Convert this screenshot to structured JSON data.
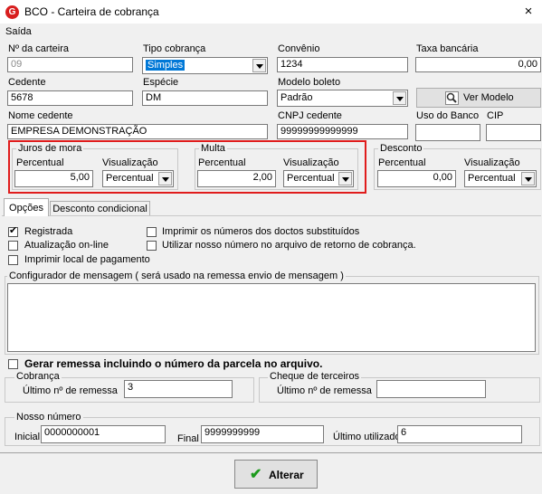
{
  "window": {
    "title": "BCO - Carteira de cobrança",
    "icon": "app-logo-icon",
    "close": "×"
  },
  "section": "Saída",
  "row1": {
    "carteira_label": "Nº da carteira",
    "carteira_value": "09",
    "tipo_label": "Tipo cobrança",
    "tipo_value": "Simples",
    "convenio_label": "Convênio",
    "convenio_value": "1234",
    "taxa_label": "Taxa bancária",
    "taxa_value": "0,00"
  },
  "row2": {
    "cedente_label": "Cedente",
    "cedente_value": "5678",
    "especie_label": "Espécie",
    "especie_value": "DM",
    "modelo_label": "Modelo boleto",
    "modelo_value": "Padrão",
    "ver_modelo_label": "Ver Modelo"
  },
  "row3": {
    "nome_label": "Nome cedente",
    "nome_value": "EMPRESA DEMONSTRAÇÃO",
    "cnpj_label": "CNPJ cedente",
    "cnpj_value": "99999999999999",
    "uso_label": "Uso do Banco",
    "uso_value": "",
    "cip_label": "CIP",
    "cip_value": ""
  },
  "juros": {
    "title": "Juros de mora",
    "percentual_label": "Percentual",
    "percentual_value": "5,00",
    "visual_label": "Visualização",
    "visual_value": "Percentual"
  },
  "multa": {
    "title": "Multa",
    "percentual_label": "Percentual",
    "percentual_value": "2,00",
    "visual_label": "Visualização",
    "visual_value": "Percentual"
  },
  "desconto": {
    "title": "Desconto",
    "percentual_label": "Percentual",
    "percentual_value": "0,00",
    "visual_label": "Visualização",
    "visual_value": "Percentual"
  },
  "tabs": [
    {
      "label": "Opções"
    },
    {
      "label": "Desconto condicional"
    }
  ],
  "options": {
    "registrada": "Registrada",
    "atualizacao": "Atualização on-line",
    "imprimir_local": "Imprimir local de pagamento",
    "imprimir_numeros": "Imprimir os números dos doctos substituídos",
    "utilizar_nosso": "Utilizar nosso número no arquivo de retorno de cobrança."
  },
  "configurador": {
    "title": "Configurador de mensagem ( será usado na remessa envio de mensagem )",
    "value": ""
  },
  "gerar_remessa": "Gerar remessa incluindo o número da parcela no arquivo.",
  "cobranca": {
    "title": "Cobrança",
    "ultimo_label": "Último nº  de remessa",
    "ultimo_value": "3"
  },
  "cheque": {
    "title": "Cheque de terceiros",
    "ultimo_label": "Último nº  de remessa",
    "ultimo_value": ""
  },
  "nosso_numero": {
    "title": "Nosso número",
    "inicial_label": "Inicial",
    "inicial_value": "0000000001",
    "final_label": "Final",
    "final_value": "9999999999",
    "ultimo_label": "Último utilizado",
    "ultimo_value": "6"
  },
  "footer": {
    "alterar_label": "Alterar",
    "alterar_icon": "checkmark-icon"
  }
}
